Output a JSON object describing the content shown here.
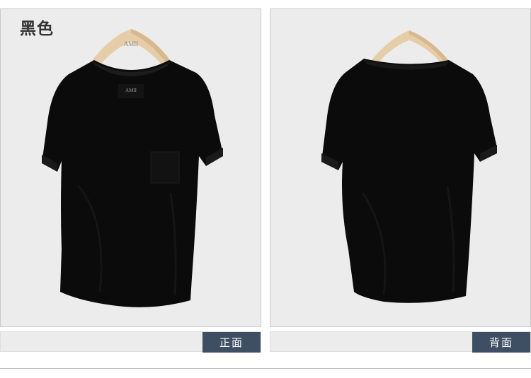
{
  "color_title": "黑色",
  "front": {
    "caption": "正面",
    "hanger_brand": "AMII",
    "neck_label_brand": "AMII"
  },
  "back": {
    "caption": "背面"
  },
  "colors": {
    "panel_bg": "#ececec",
    "caption_bg": "#3f4f63",
    "caption_text": "#ffffff",
    "shirt": "#0b0b0b",
    "hanger": "#e8cfae"
  }
}
